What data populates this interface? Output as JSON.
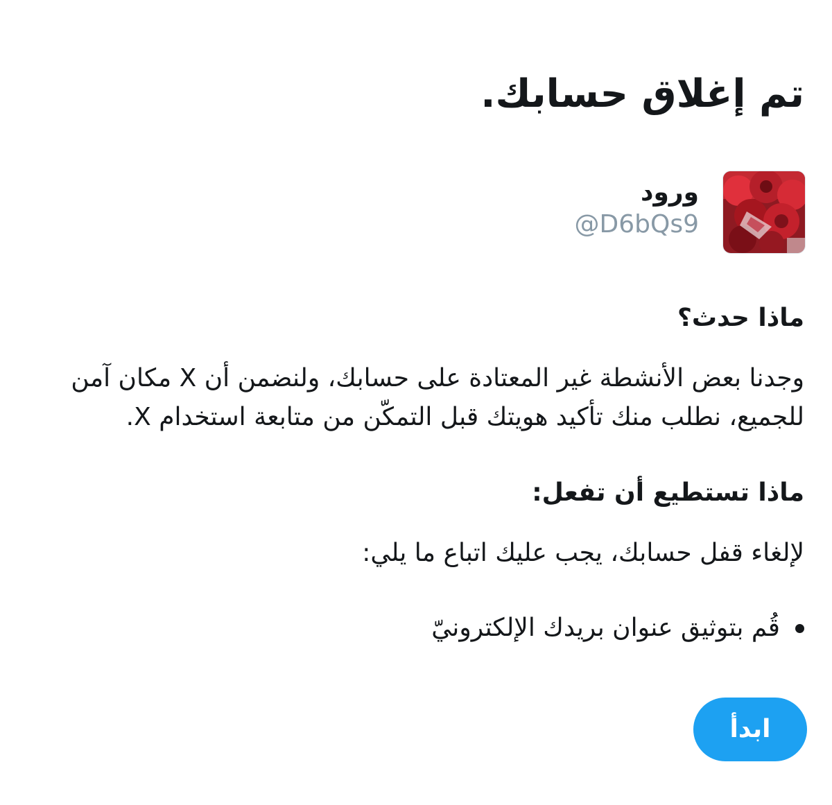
{
  "header": {
    "title": "تم إغلاق حسابك."
  },
  "profile": {
    "display_name": "ورود",
    "username": "@D6bQs9",
    "avatar_icon": "roses-avatar"
  },
  "what_happened": {
    "heading": "ماذا حدث؟",
    "text": "وجدنا بعض الأنشطة غير المعتادة على حسابك، ولنضمن أن X مكان آمن للجميع، نطلب منك تأكيد هويتك قبل التمكّن من متابعة استخدام X."
  },
  "what_you_can_do": {
    "heading": "ماذا تستطيع أن تفعل:",
    "text": "لإلغاء قفل حسابك، يجب عليك اتباع ما يلي:",
    "steps": [
      {
        "label": "قُم بتوثيق عنوان بريدك الإلكترونيّ"
      }
    ]
  },
  "actions": {
    "start_label": "ابدأ"
  },
  "colors": {
    "accent": "#1da1f2",
    "text": "#14171a",
    "muted": "#8899a6"
  }
}
